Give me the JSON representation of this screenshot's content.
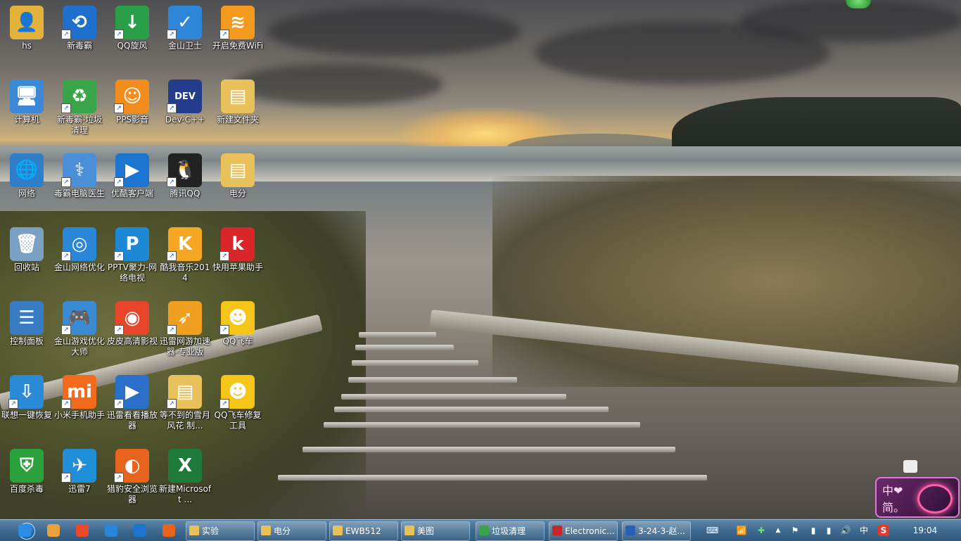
{
  "desktop": {
    "icons": [
      {
        "label": "hs",
        "color": "#e3b23a",
        "glyph": "👤",
        "shortcut": false
      },
      {
        "label": "新毒霸",
        "color": "#1f6fcc",
        "glyph": "⟲",
        "shortcut": true
      },
      {
        "label": "QQ旋风",
        "color": "#2a9f4a",
        "glyph": "↓",
        "shortcut": true
      },
      {
        "label": "金山卫士",
        "color": "#2d86d8",
        "glyph": "✓",
        "shortcut": true
      },
      {
        "label": "开启免费WiFi",
        "color": "#f39a1e",
        "glyph": "≋",
        "shortcut": true
      },
      {
        "label": "计算机",
        "color": "#3b88d6",
        "glyph": "🖥",
        "shortcut": false
      },
      {
        "label": "新毒霸-垃圾清理",
        "color": "#3aa548",
        "glyph": "♻",
        "shortcut": true
      },
      {
        "label": "PPS影音",
        "color": "#f28c1c",
        "glyph": "☺",
        "shortcut": true
      },
      {
        "label": "Dev-C++",
        "color": "#243c8c",
        "glyph": "DEV",
        "shortcut": true
      },
      {
        "label": "新建文件夹",
        "color": "#e8c15a",
        "glyph": "▤",
        "shortcut": false
      },
      {
        "label": "网络",
        "color": "#2f7fc8",
        "glyph": "🌐",
        "shortcut": false
      },
      {
        "label": "毒霸电脑医生",
        "color": "#4a8fd8",
        "glyph": "⚕",
        "shortcut": true
      },
      {
        "label": "优酷客户端",
        "color": "#1a74d0",
        "glyph": "▶",
        "shortcut": true
      },
      {
        "label": "腾讯QQ",
        "color": "#222222",
        "glyph": "🐧",
        "shortcut": true
      },
      {
        "label": "电分",
        "color": "#e8c15a",
        "glyph": "▤",
        "shortcut": false
      },
      {
        "label": "回收站",
        "color": "#7aa0c4",
        "glyph": "🗑",
        "shortcut": false
      },
      {
        "label": "金山网络优化",
        "color": "#2a86d8",
        "glyph": "◎",
        "shortcut": true
      },
      {
        "label": "PPTV聚力-网络电视",
        "color": "#1d88d6",
        "glyph": "P",
        "shortcut": true
      },
      {
        "label": "酷我音乐2014",
        "color": "#f5a623",
        "glyph": "K",
        "shortcut": true
      },
      {
        "label": "快用苹果助手",
        "color": "#d8262a",
        "glyph": "k",
        "shortcut": true
      },
      {
        "label": "控制面板",
        "color": "#3a7cc4",
        "glyph": "☰",
        "shortcut": false
      },
      {
        "label": "金山游戏优化大师",
        "color": "#3a8ad4",
        "glyph": "🎮",
        "shortcut": true
      },
      {
        "label": "皮皮高清影视",
        "color": "#e8452b",
        "glyph": "◉",
        "shortcut": true
      },
      {
        "label": "迅雷网游加速器-专业版",
        "color": "#f0a020",
        "glyph": "➶",
        "shortcut": true
      },
      {
        "label": "QQ飞车",
        "color": "#f5c518",
        "glyph": "☻",
        "shortcut": true
      },
      {
        "label": "联想一键恢复",
        "color": "#2a8ad8",
        "glyph": "⇩",
        "shortcut": true
      },
      {
        "label": "小米手机助手",
        "color": "#f26b1d",
        "glyph": "mi",
        "shortcut": true
      },
      {
        "label": "迅雷看看播放器",
        "color": "#2a70c8",
        "glyph": "▶",
        "shortcut": true
      },
      {
        "label": "等不到的雪月风花 制...",
        "color": "#e8c15a",
        "glyph": "▤",
        "shortcut": true
      },
      {
        "label": "QQ飞车修复工具",
        "color": "#f5c518",
        "glyph": "☻",
        "shortcut": true
      },
      {
        "label": "百度杀毒",
        "color": "#2aa13a",
        "glyph": "⛨",
        "shortcut": false
      },
      {
        "label": "迅雷7",
        "color": "#1f8fd8",
        "glyph": "✈",
        "shortcut": true
      },
      {
        "label": "猎豹安全浏览器",
        "color": "#e8641e",
        "glyph": "◐",
        "shortcut": true
      },
      {
        "label": "新建Microsoft ...",
        "color": "#1f7a3a",
        "glyph": "X",
        "shortcut": false
      }
    ]
  },
  "taskbar": {
    "quick_launch": [
      {
        "name": "ie-icon",
        "color": "#2e8be6"
      },
      {
        "name": "folder-gift-icon",
        "color": "#e9a23a"
      },
      {
        "name": "weibo-icon",
        "color": "#e84a2a"
      },
      {
        "name": "browser-icon",
        "color": "#2a86d8"
      },
      {
        "name": "media-icon",
        "color": "#1a74d0"
      },
      {
        "name": "firefox-icon",
        "color": "#e8641e"
      }
    ],
    "tasks": [
      {
        "label": "实验",
        "color": "#e8c15a"
      },
      {
        "label": "电分",
        "color": "#e8c15a"
      },
      {
        "label": "EWB512",
        "color": "#e8c15a"
      },
      {
        "label": "美图",
        "color": "#e8c15a"
      },
      {
        "label": "垃圾清理",
        "color": "#3aa548"
      },
      {
        "label": "Electronic...",
        "color": "#c8282a"
      },
      {
        "label": "3-24-3-赵...",
        "color": "#2a5fb8"
      }
    ],
    "tray": {
      "keyboard": "⌨",
      "network": "📶",
      "shield": "✚",
      "arrow": "▲",
      "flag": "⚑",
      "battery": "▮",
      "signal": "▮",
      "volume": "🔊",
      "ime": "中",
      "sogou": "S"
    },
    "clock": "19:04"
  },
  "ime_widget": {
    "top": "中❤",
    "bottom": "简。"
  }
}
